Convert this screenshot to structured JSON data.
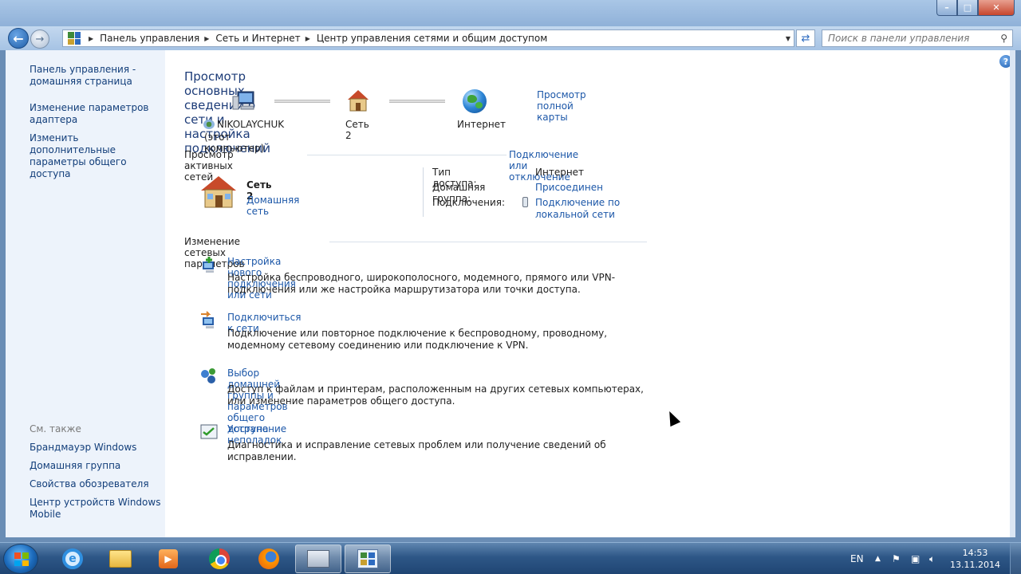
{
  "address_bar": {
    "crumbs": [
      "Панель управления",
      "Сеть и Интернет",
      "Центр управления сетями и общим доступом"
    ]
  },
  "search": {
    "placeholder": "Поиск в панели управления"
  },
  "sidebar": {
    "links": [
      "Панель управления - домашняя страница",
      "Изменение параметров адаптера",
      "Изменить дополнительные параметры общего доступа"
    ],
    "see_also_heading": "См. также",
    "see_also": [
      "Брандмауэр Windows",
      "Домашняя группа",
      "Свойства обозревателя",
      "Центр устройств Windows Mobile"
    ]
  },
  "main": {
    "title": "Просмотр основных сведений о сети и настройка подключений",
    "full_map_link": "Просмотр полной карты",
    "map": {
      "computer_name": "NIKOLAYCHUK",
      "computer_sub": "(этот компьютер)",
      "network": "Сеть  2",
      "internet": "Интернет"
    },
    "active_networks_heading": "Просмотр активных сетей",
    "connect_disconnect_link": "Подключение или отключение",
    "active_network": {
      "name": "Сеть  2",
      "type_link": "Домашняя сеть",
      "access_type_label": "Тип доступа:",
      "access_type_value": "Интернет",
      "homegroup_label": "Домашняя группа:",
      "homegroup_value": "Присоединен",
      "connections_label": "Подключения:",
      "connections_value": "Подключение по локальной сети"
    },
    "change_settings_heading": "Изменение сетевых параметров",
    "tasks": [
      {
        "title": "Настройка нового подключения или сети",
        "desc": "Настройка беспроводного, широкополосного, модемного, прямого или VPN-подключения или же настройка маршрутизатора или точки доступа."
      },
      {
        "title": "Подключиться к сети",
        "desc": "Подключение или повторное подключение к беспроводному, проводному, модемному сетевому соединению или подключение к VPN."
      },
      {
        "title": "Выбор домашней группы и параметров общего доступа",
        "desc": "Доступ к файлам и принтерам, расположенным на других сетевых компьютерах, или изменение параметров общего доступа."
      },
      {
        "title": "Устранение неполадок",
        "desc": "Диагностика и исправление сетевых проблем или получение сведений об исправлении."
      }
    ]
  },
  "taskbar": {
    "language": "EN",
    "time": "14:53",
    "date": "13.11.2014"
  },
  "colors": {
    "link": "#1c57a8",
    "title": "#1d3c78",
    "sidebar_bg": "#edf3fb",
    "taskbar": "#2e5787"
  }
}
